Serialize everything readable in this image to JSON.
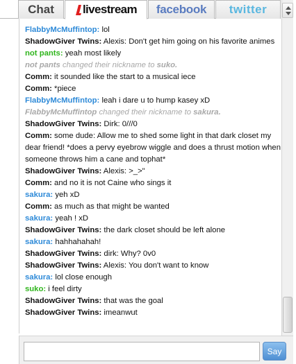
{
  "tabs": {
    "chat": "Chat",
    "livestream": "livestream",
    "facebook": "facebook",
    "twitter": "twitter"
  },
  "colors": {
    "blue_nick": "#2e8ad8",
    "green_nick": "#2fb51c",
    "black_nick": "#111111",
    "notice": "#a8a8a8",
    "livestream_red": "#e02020"
  },
  "messages": [
    {
      "nick": "FlabbyMcMuffintop:",
      "color": "#2e8ad8",
      "text": " lol"
    },
    {
      "nick": "ShadowGiver Twins:",
      "color": "#111111",
      "text": " Alexis: Don't get him going on his favorite animes"
    },
    {
      "nick": "not pants:",
      "color": "#2fb51c",
      "text": " yeah most likely"
    },
    {
      "notice": true,
      "nick": "not pants",
      "text": " changed their nickname to ",
      "newnick": "suko."
    },
    {
      "nick": "Comm:",
      "color": "#111111",
      "text": " it sounded like the start to a musical iece"
    },
    {
      "nick": "Comm:",
      "color": "#111111",
      "text": " *piece"
    },
    {
      "nick": "FlabbyMcMuffintop:",
      "color": "#2e8ad8",
      "text": " leah i dare u to hump kasey xD"
    },
    {
      "notice": true,
      "nick": "FlabbyMcMuffintop",
      "text": " changed their nickname to ",
      "newnick": "sakura."
    },
    {
      "nick": "ShadowGiver Twins:",
      "color": "#111111",
      "text": " Dirk: 0///0"
    },
    {
      "nick": "Comm:",
      "color": "#111111",
      "text": " some dude: Allow me to shed some light in that dark closet my dear friend! *does a pervy eyebrow wiggle and does a thrust motion when someone throws him a cane and tophat*"
    },
    {
      "nick": "ShadowGiver Twins:",
      "color": "#111111",
      "text": " Alexis: >_>\""
    },
    {
      "nick": "Comm:",
      "color": "#111111",
      "text": " and no it is not Caine who sings it"
    },
    {
      "nick": "sakura:",
      "color": "#2e8ad8",
      "text": " yeh xD"
    },
    {
      "nick": "Comm:",
      "color": "#111111",
      "text": " as much as that might be wanted"
    },
    {
      "nick": "sakura:",
      "color": "#2e8ad8",
      "text": " yeah ! xD"
    },
    {
      "nick": "ShadowGiver Twins:",
      "color": "#111111",
      "text": " the dark closet should be left alone"
    },
    {
      "nick": "sakura:",
      "color": "#2e8ad8",
      "text": " hahhahahah!"
    },
    {
      "nick": "ShadowGiver Twins:",
      "color": "#111111",
      "text": " dirk: Why? 0v0"
    },
    {
      "nick": "ShadowGiver Twins:",
      "color": "#111111",
      "text": " Alexis:  You don't want to know"
    },
    {
      "nick": "sakura:",
      "color": "#2e8ad8",
      "text": " lol close enough"
    },
    {
      "nick": "suko:",
      "color": "#2fb51c",
      "text": " i feel dirty"
    },
    {
      "nick": "ShadowGiver Twins:",
      "color": "#111111",
      "text": " that was the goal"
    },
    {
      "nick": "ShadowGiver Twins:",
      "color": "#111111",
      "text": " imeanwut"
    }
  ],
  "input": {
    "value": "",
    "placeholder": "",
    "send_label": "Say"
  }
}
